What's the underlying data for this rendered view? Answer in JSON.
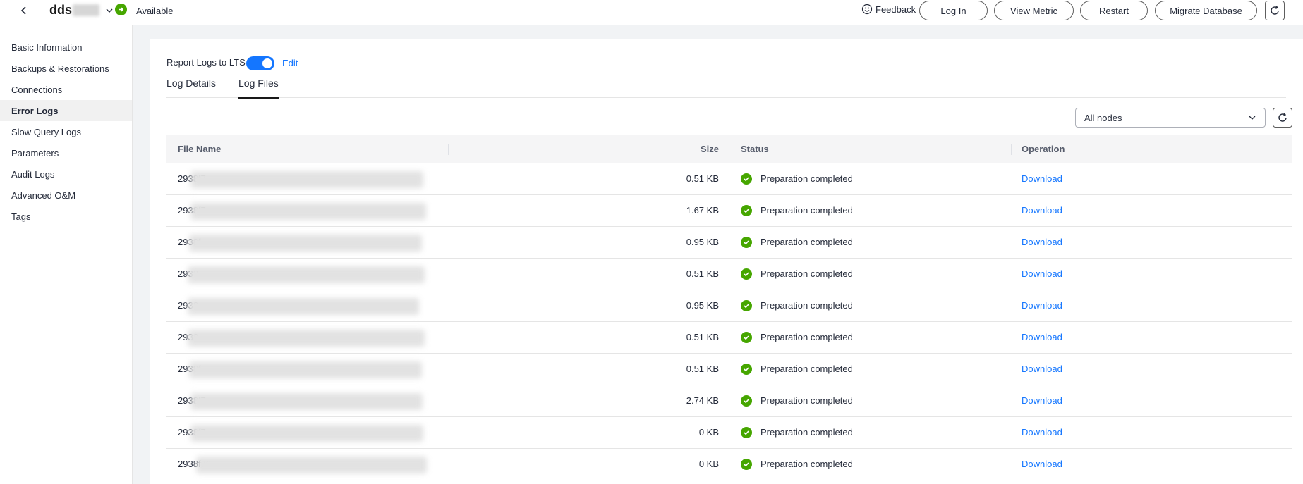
{
  "header": {
    "instance_name": "dds",
    "status": "Available",
    "feedback_label": "Feedback",
    "buttons": {
      "login": "Log In",
      "view_metric": "View Metric",
      "restart": "Restart",
      "migrate": "Migrate Database"
    }
  },
  "sidebar": {
    "items": [
      {
        "label": "Basic Information"
      },
      {
        "label": "Backups & Restorations"
      },
      {
        "label": "Connections"
      },
      {
        "label": "Error Logs",
        "active": true
      },
      {
        "label": "Slow Query Logs"
      },
      {
        "label": "Parameters"
      },
      {
        "label": "Audit Logs"
      },
      {
        "label": "Advanced O&M"
      },
      {
        "label": "Tags"
      }
    ]
  },
  "main": {
    "report_label": "Report Logs to LTS",
    "report_enabled": true,
    "edit_label": "Edit",
    "tabs": [
      {
        "label": "Log Details"
      },
      {
        "label": "Log Files",
        "active": true
      }
    ],
    "node_filter": "All nodes",
    "table": {
      "columns": [
        "File Name",
        "Size",
        "Status",
        "Operation"
      ],
      "rows": [
        {
          "file": "2938f7",
          "size": "0.51 KB",
          "status": "Preparation completed",
          "action": "Download"
        },
        {
          "file": "2938f7",
          "size": "1.67 KB",
          "status": "Preparation completed",
          "action": "Download"
        },
        {
          "file": "2938f",
          "size": "0.95 KB",
          "status": "Preparation completed",
          "action": "Download"
        },
        {
          "file": "2938",
          "size": "0.51 KB",
          "status": "Preparation completed",
          "action": "Download"
        },
        {
          "file": "2938",
          "size": "0.95 KB",
          "status": "Preparation completed",
          "action": "Download"
        },
        {
          "file": "2938",
          "size": "0.51 KB",
          "status": "Preparation completed",
          "action": "Download"
        },
        {
          "file": "2938f",
          "size": "0.51 KB",
          "status": "Preparation completed",
          "action": "Download"
        },
        {
          "file": "2938f7",
          "size": "2.74 KB",
          "status": "Preparation completed",
          "action": "Download"
        },
        {
          "file": "2938f7",
          "size": "0 KB",
          "status": "Preparation completed",
          "action": "Download"
        },
        {
          "file": "2938f76",
          "size": "0 KB",
          "status": "Preparation completed",
          "action": "Download"
        }
      ]
    }
  },
  "colors": {
    "accent": "#1476ff",
    "success": "#46a600",
    "text": "#252b3a"
  },
  "icons": [
    "back-arrow-icon",
    "chevron-down-icon",
    "status-ok-icon",
    "feedback-smile-icon",
    "refresh-icon",
    "check-circle-icon"
  ]
}
